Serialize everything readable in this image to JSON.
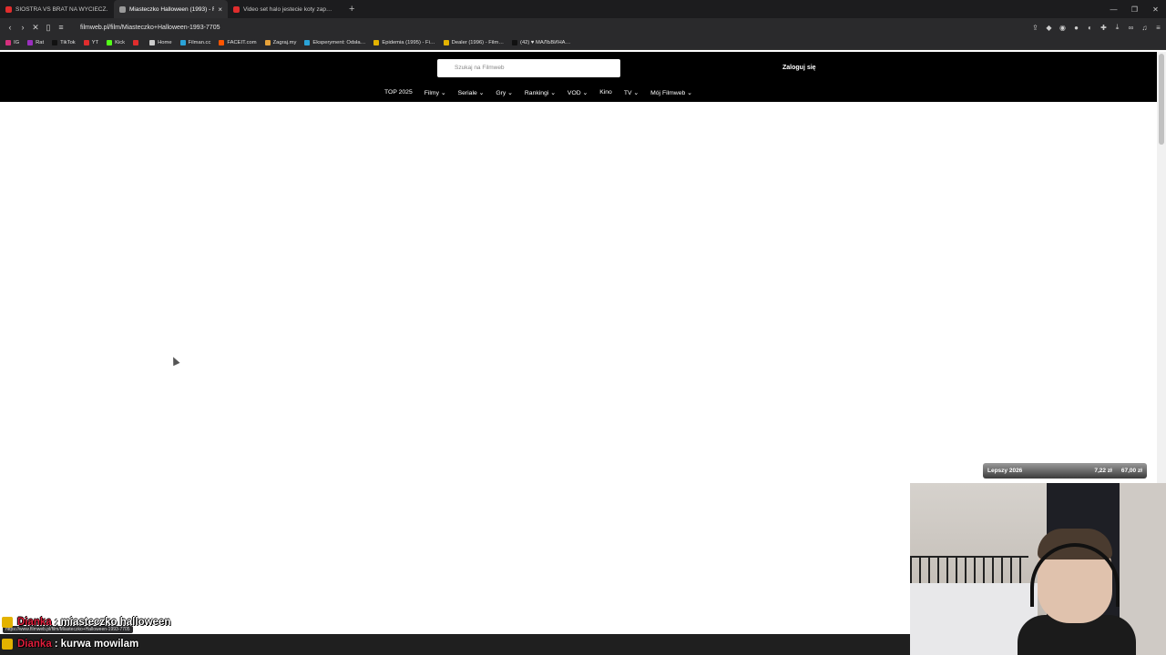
{
  "browser": {
    "tabs": [
      {
        "title": "SIOSTRA VS BRAT NA WYCIECZ…",
        "color": "#e02d2d",
        "active": false
      },
      {
        "title": "Miasteczko Halloween (1993) - F",
        "color": "#9a9a9a",
        "active": true
      },
      {
        "title": "Video set halo jestecie koty zap…",
        "color": "#e02d2d",
        "active": false
      }
    ],
    "url": "filmweb.pl/film/Miasteczko+Halloween-1993-7705",
    "status_url": "https://www.filmweb.pl/film/Miasteczko+Halloween-1993-7705"
  },
  "bookmarks": [
    {
      "label": "IG",
      "color": "#d6307e"
    },
    {
      "label": "Rat",
      "color": "#9b2fbf"
    },
    {
      "label": "TikTok",
      "color": "#111111"
    },
    {
      "label": "YT",
      "color": "#e02d2d"
    },
    {
      "label": "Kick",
      "color": "#53fc18"
    },
    {
      "label": "",
      "color": "#e02d2d"
    },
    {
      "label": "Home",
      "color": "#cccccc"
    },
    {
      "label": "Filman.cc",
      "color": "#2aa3d8"
    },
    {
      "label": "FACEIT.com",
      "color": "#ff5500"
    },
    {
      "label": "Zagraj.my",
      "color": "#e8a33a"
    },
    {
      "label": "Eksperyment: Odsła…",
      "color": "#2aa3d8"
    },
    {
      "label": "Epidemia (1995) - Fi…",
      "color": "#e3b200"
    },
    {
      "label": "Dealer (1996) - Film…",
      "color": "#e3b200"
    },
    {
      "label": "(42) ♥ МАЛЬВИНА…",
      "color": "#111111"
    }
  ],
  "site": {
    "search_placeholder": "Szukaj na Filmweb",
    "login": "Zaloguj się",
    "nav": [
      "TOP 2025",
      "Filmy ⌄",
      "Seriale ⌄",
      "Gry ⌄",
      "Rankingi ⌄",
      "VOD ⌄",
      "Kino",
      "TV ⌄",
      "Mój Filmweb ⌄"
    ]
  },
  "overlay": {
    "price_widget": {
      "name": "Lepszy 2026",
      "price1": "7,22 zł",
      "price2": "67,00 zł"
    },
    "chat": [
      {
        "user": "Dianka",
        "sep": ":",
        "message": "miasteczko halloween"
      },
      {
        "user": "Dianka",
        "sep": ":",
        "message": "kurwa mowilam"
      }
    ]
  }
}
